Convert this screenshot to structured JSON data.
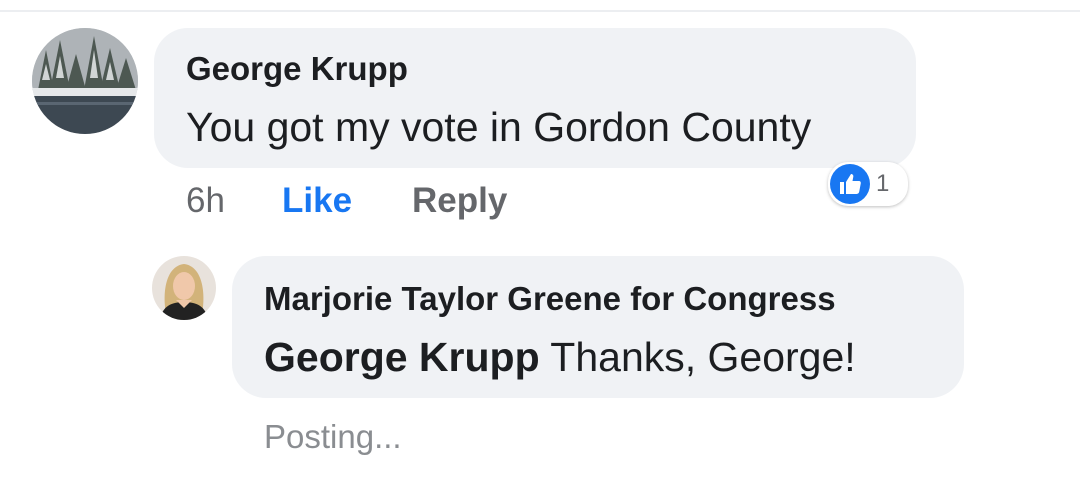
{
  "comment": {
    "author": "George Krupp",
    "text": "You got my vote in Gordon County",
    "time": "6h",
    "like_label": "Like",
    "reply_label": "Reply",
    "reaction_icon": "thumbs-up-icon",
    "reaction_count": "1"
  },
  "reply": {
    "author": "Marjorie Taylor Greene for Congress",
    "mention": "George Krupp",
    "text": "Thanks, George!",
    "status": "Posting..."
  },
  "colors": {
    "link_blue": "#1877f2",
    "bubble_gray": "#f0f2f5",
    "meta_gray": "#65676b"
  }
}
